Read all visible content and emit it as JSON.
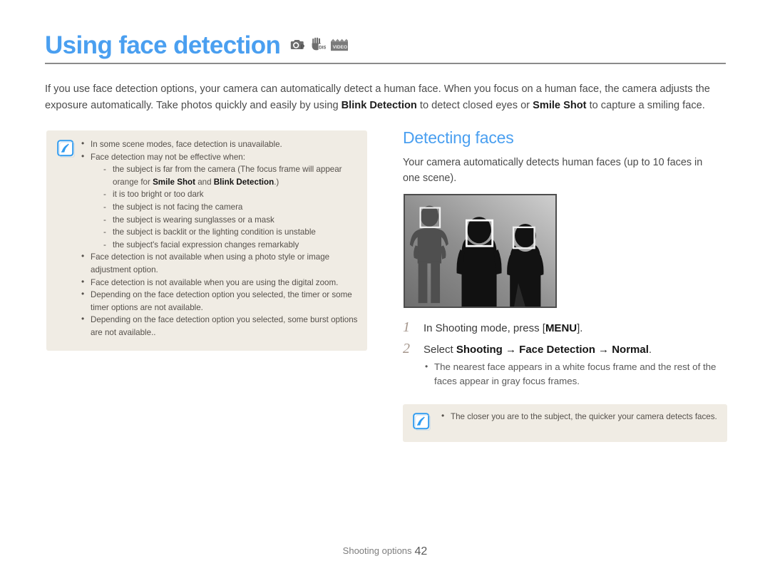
{
  "header": {
    "title": "Using face detection",
    "mode_icons": [
      {
        "name": "camera-program-icon",
        "label": "P"
      },
      {
        "name": "hand-dis-icon",
        "label": "DIS"
      },
      {
        "name": "video-icon",
        "label": "VIDEO"
      }
    ]
  },
  "intro": {
    "part1": "If you use face detection options, your camera can automatically detect a human face. When you focus on a human face, the camera adjusts the exposure automatically. Take photos quickly and easily by using ",
    "bold1": "Blink Detection",
    "part2": " to detect closed eyes or ",
    "bold2": "Smile Shot",
    "part3": " to capture a smiling face."
  },
  "note_box": {
    "icon": "note-pen-icon",
    "items": [
      {
        "text": "In some scene modes, face detection is unavailable."
      },
      {
        "text": "Face detection may not be effective when:",
        "sub": [
          {
            "pre": "the subject is far from the camera (The focus frame will appear orange for ",
            "bold1": "Smile Shot",
            "mid": " and ",
            "bold2": "Blink Detection",
            "post": ".)"
          },
          {
            "pre": "it is too bright or too dark"
          },
          {
            "pre": "the subject is not facing the camera"
          },
          {
            "pre": "the subject is wearing sunglasses or a mask"
          },
          {
            "pre": "the subject is backlit or the lighting condition is unstable"
          },
          {
            "pre": "the subject's facial expression changes remarkably"
          }
        ]
      },
      {
        "text": "Face detection is not available when using a photo style or image adjustment option."
      },
      {
        "text": "Face detection is not available when you are using the digital zoom."
      },
      {
        "text": "Depending on the face detection option you selected, the timer or some timer options are not available."
      },
      {
        "text": "Depending on the face detection option you selected, some burst options are not available.."
      }
    ]
  },
  "right": {
    "subtitle": "Detecting faces",
    "paragraph": "Your camera automatically detects human faces (up to 10 faces in one scene).",
    "photo": {
      "name": "face-detection-preview-image",
      "alt": "Three people silhouettes with white face detection focus frames"
    },
    "steps": [
      {
        "num": "1",
        "pre": "In Shooting mode, press [",
        "bold": "MENU",
        "post": "]."
      },
      {
        "num": "2",
        "pre": "Select ",
        "bold": "Shooting → Face Detection → Normal",
        "post": ".",
        "sub": [
          "The nearest face appears in a white focus frame and the rest of the faces appear in gray focus frames."
        ]
      }
    ],
    "tip_box": {
      "icon": "note-pen-icon",
      "items": [
        "The closer you are to the subject, the quicker your camera detects faces."
      ]
    }
  },
  "footer": {
    "section": "Shooting options",
    "page": "42"
  },
  "colors": {
    "accent_blue": "#4a9ff0",
    "note_bg": "#f0ece4",
    "rule_gray": "#8b8b8b",
    "step_num": "#a5968c"
  }
}
